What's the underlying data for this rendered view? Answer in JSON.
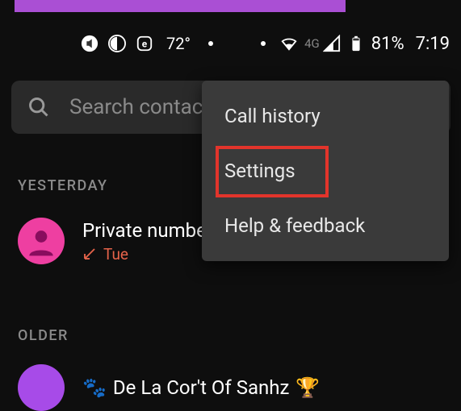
{
  "status": {
    "temperature": "72°",
    "network_label": "4G",
    "battery_percent": "81%",
    "time": "7:19"
  },
  "search": {
    "placeholder": "Search contacts & places"
  },
  "sections": {
    "yesterday": "YESTERDAY",
    "older": "OLDER"
  },
  "calls": [
    {
      "name": "Private number",
      "day": "Tue",
      "avatar_color": "#ee3fa1",
      "missed": true
    },
    {
      "name": "De La Cor't Of Sanhz",
      "prefix_emoji": "🐾",
      "suffix_emoji": "🏆",
      "avatar_color": "#a74be8"
    }
  ],
  "menu": {
    "items": [
      {
        "label": "Call history"
      },
      {
        "label": "Settings",
        "highlighted": true
      },
      {
        "label": "Help & feedback"
      }
    ]
  }
}
